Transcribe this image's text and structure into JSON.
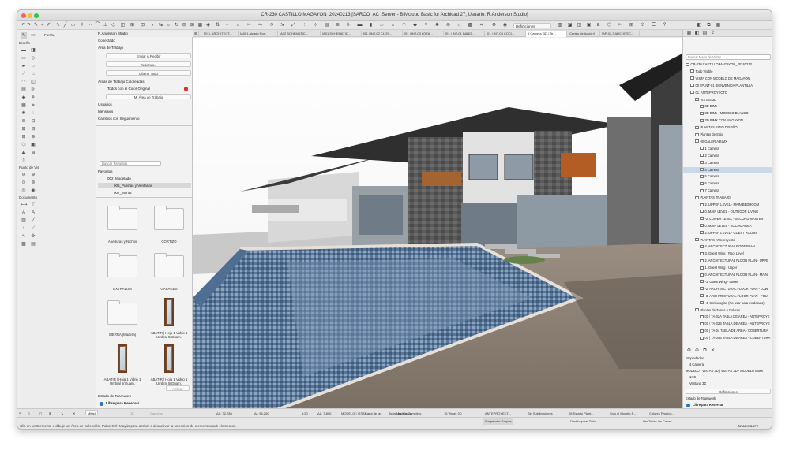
{
  "window": {
    "title": "CR-230 CASTILLO MAGAYON_20240213 [SARCO_AC_Server - BIMcloud Basic for Archicad 27, Usuario: R.Anderson Studio]"
  },
  "toolbar": {
    "definitions_label": "Definiciones"
  },
  "tabs": [
    "[0] 3. ARCHITECT...",
    "[A001 Alzado Nor...",
    "[A02 SCHEMATIC...",
    "[A01 SCHEMATIC...",
    "[01 | INT-02 CLOS...",
    "[01 | INT-03 LOZA...",
    "[01 | INT-01 BAÑO...",
    "[01 | INT-03 COCI...",
    "4 Camera [3D / Te...",
    "[Centro de Acción]",
    "[AP-02.3 ARCHITEC..."
  ],
  "toolbox": {
    "select_label": "Flecha",
    "section_design": "Diseño",
    "section_view": "Punto de Vis",
    "section_document": "Documento"
  },
  "panel": {
    "user": "R.Anderson Studio",
    "connected": "Conectado",
    "workspace": "Área de Trabajo",
    "send_receive": "Enviar & Recibir",
    "reserve": "Reservar...",
    "release_all": "Liberar Todo",
    "colored_areas": "Áreas de Trabajo Coloreadas:",
    "all_original_color": "Todos con el Color Original",
    "my_workspace": "Mi Área de Trabajo",
    "users": "Usuarios",
    "messages": "Mensajes",
    "tracked_changes": "Cambios con Seguimiento",
    "search_placeholder": "Buscar Favoritos",
    "favorites": "Favoritos",
    "modeled": "002_Modelado",
    "doors_windows": "005_Puertas y Ventanas",
    "walls": "007_Muros",
    "folders": [
      "Aberturas y Nichos",
      "CORTIZO",
      "EXTRALUM",
      "GARAGES",
      "SIERRA (Madera)",
      "ABATIR | Hoja 1 Vidrio 1 Umbral 5(Guarn.",
      "ABATIR | Hoja 1 Vidrio 1 Umbral 5(Guarn.",
      "ABATIR | Hoja 1 Vidrio 1 Umbral 5(Guarn."
    ],
    "apply": "Aplicar",
    "teamwork_status": "Estado de Teamwork",
    "free_to_reserve": "Libre para Reservar",
    "reserve_btn": "Reservar"
  },
  "navigator": {
    "search_placeholder": "Buscar Mapa de Vistas",
    "items": [
      {
        "label": "CR-230 CASTILLO MAGAYON_20240213",
        "indent": 0
      },
      {
        "label": "Todo Visible",
        "indent": 1
      },
      {
        "label": "VISTA CON MODELO DE MAGAYON",
        "indent": 1
      },
      {
        "label": "00 | PLNT-01 BIENVENIDA PLANTILLA",
        "indent": 1
      },
      {
        "label": "01. ANTEPROYECTO",
        "indent": 1
      },
      {
        "label": "VISTAS 3D",
        "indent": 2
      },
      {
        "label": "3D BIMx",
        "indent": 3
      },
      {
        "label": "3D BIMx - MODELO BLANCO",
        "indent": 3
      },
      {
        "label": "3D BIMX CON MAGAYON",
        "indent": 3
      },
      {
        "label": "PLANTAS SITIO DISEÑO",
        "indent": 2
      },
      {
        "label": "Plantas de Sitio",
        "indent": 2
      },
      {
        "label": "00 GALERIA BIMX",
        "indent": 2
      },
      {
        "label": "1 Camera",
        "indent": 3
      },
      {
        "label": "2 Camera",
        "indent": 3
      },
      {
        "label": "3 Camera",
        "indent": 3
      },
      {
        "label": "4 Camera",
        "indent": 3,
        "selected": true
      },
      {
        "label": "5 Camera",
        "indent": 3
      },
      {
        "label": "6 Camera",
        "indent": 3
      },
      {
        "label": "7 Camera",
        "indent": 3
      },
      {
        "label": "PLANTAS TRABAJO",
        "indent": 2
      },
      {
        "label": "2. UPPER LEVEL - MAIN BEDROOM",
        "indent": 3
      },
      {
        "label": "0. MAIN LEVEL - OUTDOOR LIVING",
        "indent": 3
      },
      {
        "label": "-2. LOWER LEVEL - SECOND MASTER",
        "indent": 3
      },
      {
        "label": "0. MAIN LEVEL - SOCIAL AREA",
        "indent": 3
      },
      {
        "label": "2. UPPER LEVEL - GUEST ROOMS",
        "indent": 3
      },
      {
        "label": "PLANTAS ANteproyecto",
        "indent": 2
      },
      {
        "label": "4. ARCHITECTURAL ROOF PLAN",
        "indent": 3
      },
      {
        "label": "3. Guest Wing - Roof Level",
        "indent": 3
      },
      {
        "label": "2. ARCHITECTURAL FLOOR PLAN - UPPE",
        "indent": 3
      },
      {
        "label": "1. Guest Wing - Upper",
        "indent": 3
      },
      {
        "label": "0. ARCHITECTURAL FLOOR PLAN - MAIN",
        "indent": 3
      },
      {
        "label": "-1. Guest Wing - Lower",
        "indent": 3
      },
      {
        "label": "-2. ARCHITECTURAL FLOOR PLAN - LOW",
        "indent": 3
      },
      {
        "label": "-3. ARCHITECTURAL FLOOR PLAN - FOU",
        "indent": 3
      },
      {
        "label": "-4. Simbologías (No usar para modelado)",
        "indent": 3
      },
      {
        "label": "Plantas de Zonas a Colores",
        "indent": 2
      },
      {
        "label": "01 | TA-02A TABLA DE AREA - ANTEPROYE",
        "indent": 3
      },
      {
        "label": "01 | TA-02B TABLA DE AREA - ANTEPROYE",
        "indent": 3
      },
      {
        "label": "01 | TA-04 TABLA DE AREA - COBERTURA",
        "indent": 3
      },
      {
        "label": "01 | TA-04B TABLA DE AREA - COBERTURA",
        "indent": 3
      }
    ],
    "properties_title": "Propiedades",
    "prop_name": "4 Camera",
    "prop_path": "MODELO | VISTAS 3D | VISTAS 3D - MODELO BIMX",
    "prop_scale": "1:50",
    "prop_ventana": "Ventana 3D",
    "definitions": "Definiciones",
    "teamwork_status": "Estado de Teamwork",
    "free_to_reserve": "Libre para Reservar",
    "reserve_btn": "Reservar"
  },
  "coords": {
    "dx": "ΔX: 32.786",
    "dy": "ΔY: -25.391",
    "ar": "Δr: 96.200",
    "angle": "a: 344.70°",
    "dz": "ΔZ: 3.800",
    "ref": "a Cota Cero de...",
    "mitad": "Mitad",
    "ok": "OK",
    "cancel": "Cancelar"
  },
  "bottombar": {
    "scale": "1:50",
    "layer": "MODELO | VISTA...",
    "model": "Modelo Completo",
    "views3d": "15 Vistas 3D",
    "anteproyecto": "ANTEPROYECT...",
    "subdivisions": "Sin Subdivisiones",
    "state": "06 Estado Plant...",
    "model_only": "Solo el Modelo P...",
    "colors": "Colores Propios...",
    "suspend_groups": "Suspender Grupos",
    "unlock_all": "Desbloquear Todo",
    "show_layers": "Ver Todas las Capas",
    "layer_label": "Capa de las",
    "all_layers": "Todas las Capas"
  },
  "status_text": "Clic en un Elemento o dibuje un Área de Selección. Pulse Ctrl+Mayús para activar o desactivar la selección de elementos/sub-elementos.",
  "brand": "GRAPHISOFT"
}
